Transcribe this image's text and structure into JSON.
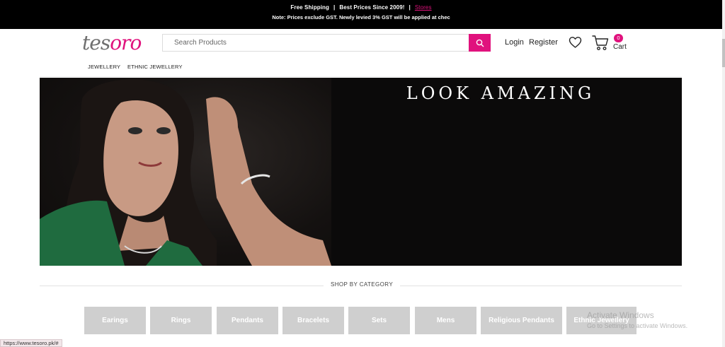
{
  "announcement": {
    "free_shipping": "Free Shipping",
    "best_prices": "Best Prices Since 2009!",
    "stores_link": "Stores",
    "note": "Note: Prices exclude GST. Newly levied 3% GST will be applied at chec"
  },
  "logo": {
    "part1": "tes",
    "part2": "oro"
  },
  "search": {
    "placeholder": "Search Products"
  },
  "header": {
    "login": "Login",
    "register": "Register",
    "cart_count": "0",
    "cart_label": "Cart"
  },
  "nav": {
    "items": [
      "JEWELLERY",
      "ETHNIC JEWELLERY"
    ]
  },
  "banner": {
    "headline": "LOOK AMAZING"
  },
  "shop": {
    "title": "SHOP BY CATEGORY",
    "categories": [
      "Earings",
      "Rings",
      "Pendants",
      "Bracelets",
      "Sets",
      "Mens",
      "Religious Pendants",
      "Ethnic Jewellery"
    ]
  },
  "os": {
    "watermark_title": "Activate Windows",
    "watermark_sub": "Go to Settings to activate Windows."
  },
  "status": {
    "url": "https://www.tesoro.pk/#"
  },
  "colors": {
    "accent": "#e0127d",
    "topbar": "#000000",
    "category_tile": "#cfcfcf"
  },
  "icons": [
    "search-icon",
    "heart-icon",
    "cart-icon"
  ]
}
